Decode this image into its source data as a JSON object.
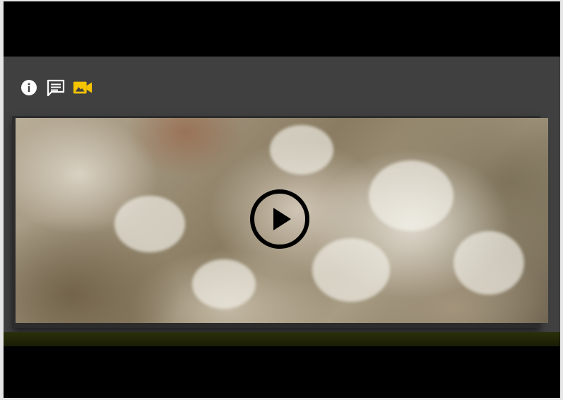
{
  "toolbar": {
    "icons": [
      "info-icon",
      "comment-icon",
      "video-camera-icon"
    ],
    "accent_color": "#f5c400"
  },
  "video": {
    "play_icon": "play-circle-icon"
  },
  "colors": {
    "panel": "#404040",
    "background": "#000000"
  }
}
